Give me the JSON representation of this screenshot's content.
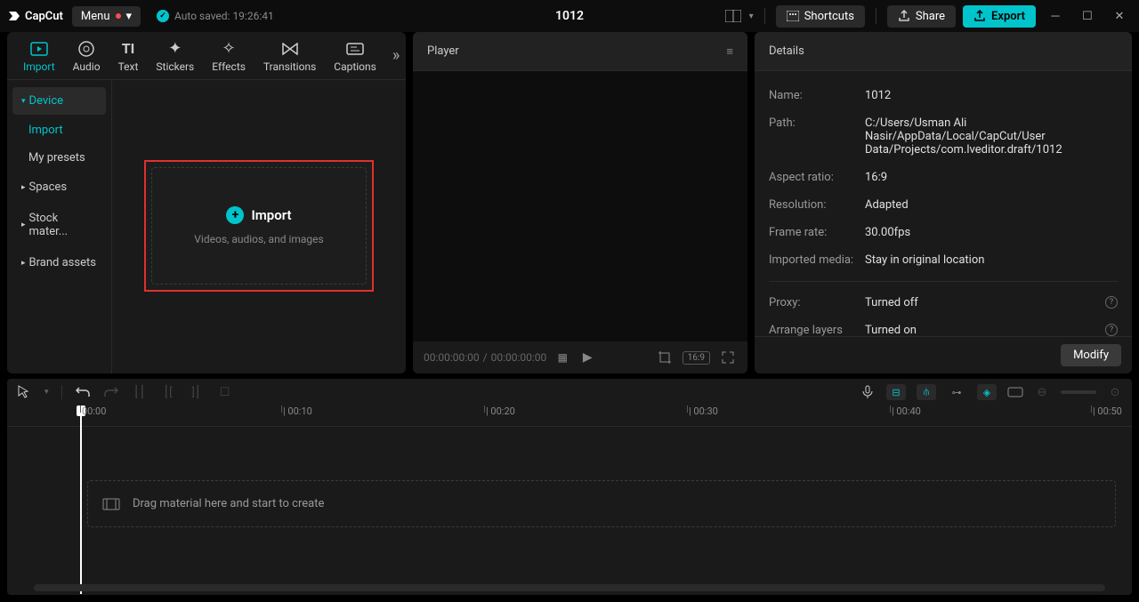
{
  "app": {
    "name": "CapCut"
  },
  "titlebar": {
    "menu": "Menu",
    "autosave": "Auto saved: 19:26:41",
    "project_title": "1012",
    "shortcuts": "Shortcuts",
    "share": "Share",
    "export": "Export"
  },
  "media_tabs": {
    "import": "Import",
    "audio": "Audio",
    "text": "Text",
    "stickers": "Stickers",
    "effects": "Effects",
    "transitions": "Transitions",
    "captions": "Captions"
  },
  "side_nav": {
    "device": "Device",
    "import": "Import",
    "my_presets": "My presets",
    "spaces": "Spaces",
    "stock": "Stock mater...",
    "brand": "Brand assets"
  },
  "import_box": {
    "title": "Import",
    "subtitle": "Videos, audios, and images"
  },
  "player": {
    "title": "Player",
    "time_current": "00:00:00:00",
    "time_sep": "/",
    "time_total": "00:00:00:00",
    "ratio": "16:9"
  },
  "details": {
    "title": "Details",
    "rows": {
      "name_label": "Name:",
      "name_value": "1012",
      "path_label": "Path:",
      "path_value": "C:/Users/Usman Ali Nasir/AppData/Local/CapCut/User Data/Projects/com.lveditor.draft/1012",
      "aspect_label": "Aspect ratio:",
      "aspect_value": "16:9",
      "resolution_label": "Resolution:",
      "resolution_value": "Adapted",
      "framerate_label": "Frame rate:",
      "framerate_value": "30.00fps",
      "imported_label": "Imported media:",
      "imported_value": "Stay in original location",
      "proxy_label": "Proxy:",
      "proxy_value": "Turned off",
      "layers_label": "Arrange layers",
      "layers_value": "Turned on"
    },
    "modify": "Modify"
  },
  "timeline": {
    "marks": [
      "00:00",
      "| 00:10",
      "| 00:20",
      "| 00:30",
      "| 00:40",
      "| 00:50"
    ],
    "drop_hint": "Drag material here and start to create"
  }
}
